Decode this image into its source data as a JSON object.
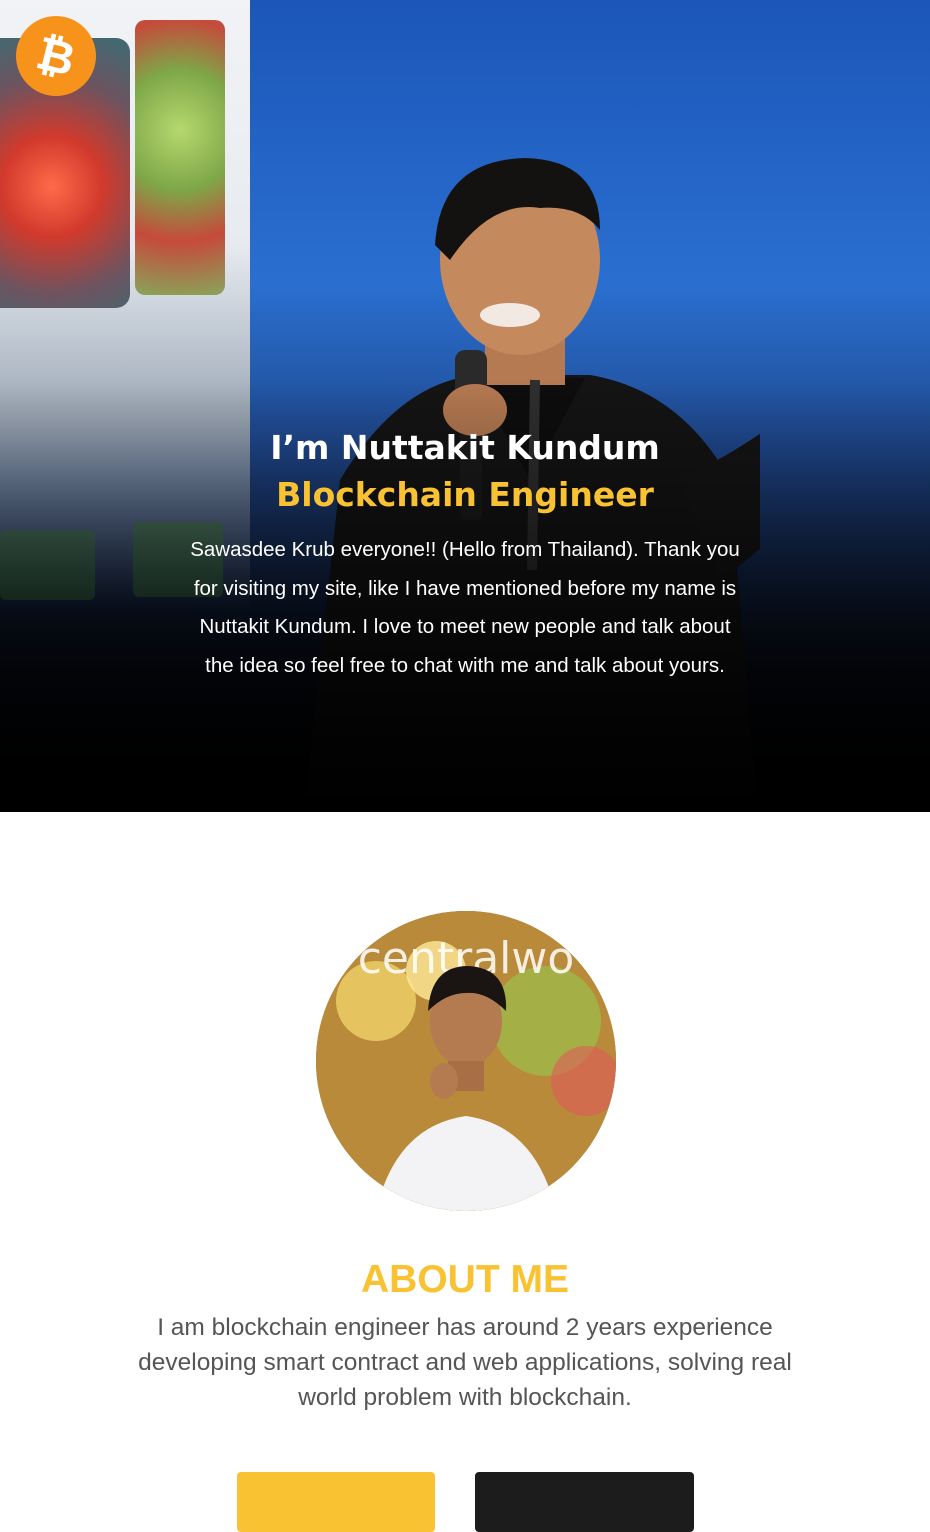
{
  "brand": {
    "logo_icon": "bitcoin-icon",
    "logo_color": "#f7931a"
  },
  "hero": {
    "name": "I’m Nuttakit Kundum",
    "role": "Blockchain Engineer",
    "description": "Sawasdee Krub everyone!! (Hello from Thailand). Thank you for visiting my site, like I have mentioned before my name is Nuttakit Kundum. I love to meet new people and talk about the idea so feel free to chat with me and talk about yours."
  },
  "about": {
    "title": "ABOUT ME",
    "text": "I am blockchain engineer has around 2 years experience developing smart contract and web applications, solving real world problem with blockchain."
  },
  "colors": {
    "accent": "#f9c233",
    "dark_button": "#1c1c1c",
    "body_text": "#555555"
  }
}
